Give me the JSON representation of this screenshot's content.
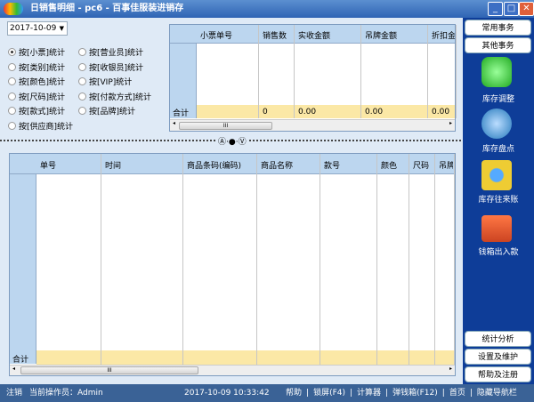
{
  "window": {
    "title": "日销售明细 - pc6 - 百事佳服装进销存",
    "minimize": "_",
    "maximize": "□",
    "close": "✕"
  },
  "filter": {
    "date": "2017-10-09",
    "options": [
      {
        "label": "按[小票]统计",
        "selected": true
      },
      {
        "label": "按[类别]统计",
        "selected": false
      },
      {
        "label": "按[颜色]统计",
        "selected": false
      },
      {
        "label": "按[尺码]统计",
        "selected": false
      },
      {
        "label": "按[款式]统计",
        "selected": false
      },
      {
        "label": "按[供应商]统计",
        "selected": false
      },
      {
        "label": "按[营业员]统计",
        "selected": false
      },
      {
        "label": "按[收银员]统计",
        "selected": false
      },
      {
        "label": "按[VIP]统计",
        "selected": false
      },
      {
        "label": "按[付款方式]统计",
        "selected": false
      },
      {
        "label": "按[品牌]统计",
        "selected": false
      }
    ]
  },
  "top_grid": {
    "columns": [
      "小票单号",
      "销售数",
      "实收金额",
      "吊牌金额",
      "折扣金"
    ],
    "total_label": "合计",
    "totals": [
      "",
      "0",
      "0.00",
      "0.00",
      "0.00"
    ]
  },
  "bottom_grid": {
    "columns": [
      "单号",
      "时间",
      "商品条码(编码)",
      "商品名称",
      "款号",
      "颜色",
      "尺码",
      "吊牌价"
    ],
    "total_label": "合计"
  },
  "sidebar": {
    "tabs": [
      "常用事务",
      "其他事务"
    ],
    "items": [
      "库存调整",
      "库存盘点",
      "库存往来账",
      "钱箱出入款"
    ],
    "bottom": [
      "统计分析",
      "设置及维护",
      "帮助及注册"
    ]
  },
  "status": {
    "logout": "注销",
    "operator": "当前操作员：Admin",
    "datetime": "2017-10-09 10:33:42",
    "links": [
      "帮助",
      "锁屏(F4)",
      "计算器",
      "弹钱箱(F12)",
      "首页",
      "隐藏导航栏"
    ]
  }
}
